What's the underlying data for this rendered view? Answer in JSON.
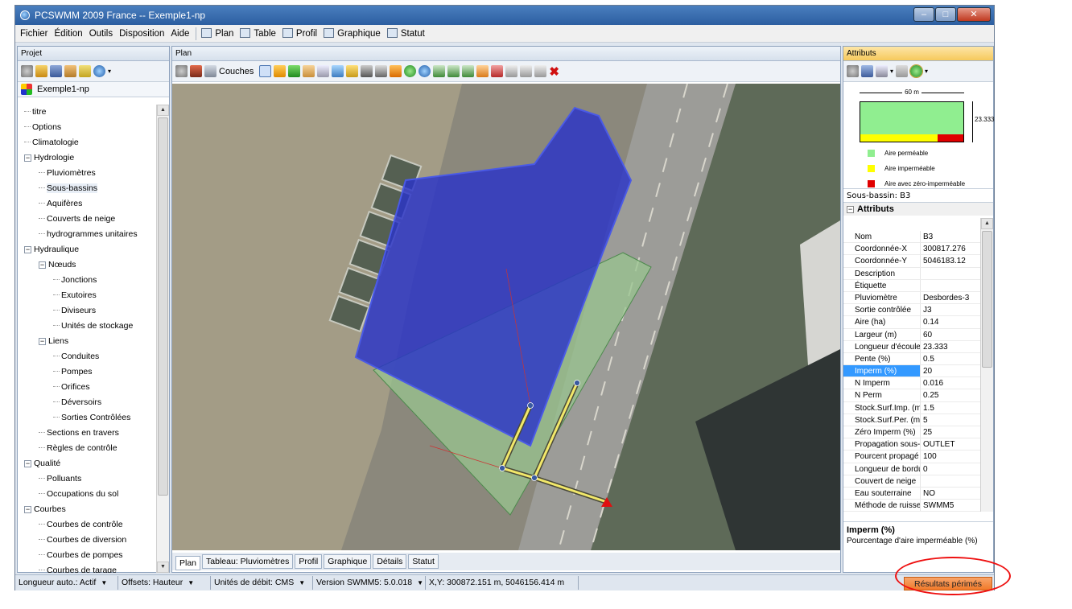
{
  "window": {
    "title": "PCSWMM 2009 France -- Exemple1-np",
    "controls": [
      "–",
      "□",
      "✕"
    ]
  },
  "menu": {
    "items": [
      "Fichier",
      "Édition",
      "Outils",
      "Disposition",
      "Aide"
    ],
    "view_items": [
      "Plan",
      "Table",
      "Profil",
      "Graphique",
      "Statut"
    ]
  },
  "project": {
    "header": "Projet",
    "root": "Exemple1-np",
    "tree": [
      {
        "label": "titre",
        "level": 0
      },
      {
        "label": "Options",
        "level": 0
      },
      {
        "label": "Climatologie",
        "level": 0
      },
      {
        "label": "Hydrologie",
        "level": 0,
        "expander": "−"
      },
      {
        "label": "Pluviomètres",
        "level": 1
      },
      {
        "label": "Sous-bassins",
        "level": 1
      },
      {
        "label": "Aquifères",
        "level": 1
      },
      {
        "label": "Couverts de neige",
        "level": 1
      },
      {
        "label": "hydrogrammes unitaires",
        "level": 1
      },
      {
        "label": "Hydraulique",
        "level": 0,
        "expander": "−"
      },
      {
        "label": "Nœuds",
        "level": 1,
        "expander": "−"
      },
      {
        "label": "Jonctions",
        "level": 2
      },
      {
        "label": "Exutoires",
        "level": 2
      },
      {
        "label": "Diviseurs",
        "level": 2
      },
      {
        "label": "Unités de stockage",
        "level": 2
      },
      {
        "label": "Liens",
        "level": 1,
        "expander": "−"
      },
      {
        "label": "Conduites",
        "level": 2
      },
      {
        "label": "Pompes",
        "level": 2
      },
      {
        "label": "Orifices",
        "level": 2
      },
      {
        "label": "Déversoirs",
        "level": 2
      },
      {
        "label": "Sorties Contrôlées",
        "level": 2
      },
      {
        "label": "Sections en travers",
        "level": 1
      },
      {
        "label": "Règles de contrôle",
        "level": 1
      },
      {
        "label": "Qualité",
        "level": 0,
        "expander": "−"
      },
      {
        "label": "Polluants",
        "level": 1
      },
      {
        "label": "Occupations du sol",
        "level": 1
      },
      {
        "label": "Courbes",
        "level": 0,
        "expander": "−"
      },
      {
        "label": "Courbes de contrôle",
        "level": 1
      },
      {
        "label": "Courbes de diversion",
        "level": 1
      },
      {
        "label": "Courbes de pompes",
        "level": 1
      },
      {
        "label": "Courbes de tarage",
        "level": 1
      }
    ]
  },
  "plan": {
    "header": "Plan",
    "layers_label": "Couches",
    "tabs": [
      "Plan",
      "Tableau: Pluviomètres",
      "Profil",
      "Graphique",
      "Détails",
      "Statut"
    ]
  },
  "attributes": {
    "header": "Attributs",
    "width_label": "60 m",
    "length_label": "23.333",
    "legend": [
      {
        "label": "Aire perméable",
        "color": "#90ee90"
      },
      {
        "label": "Aire imperméable",
        "color": "#ffff00"
      },
      {
        "label": "Aire avec zéro-imperméable",
        "color": "#e00000"
      }
    ],
    "subtitle": "Sous-bassin:  B3",
    "section": "Attributs",
    "rows": [
      {
        "k": "Nom",
        "v": "B3"
      },
      {
        "k": "Coordonnée-X",
        "v": "300817.276"
      },
      {
        "k": "Coordonnée-Y",
        "v": "5046183.12"
      },
      {
        "k": "Description",
        "v": ""
      },
      {
        "k": "Étiquette",
        "v": ""
      },
      {
        "k": "Pluviomètre",
        "v": "Desbordes-3"
      },
      {
        "k": "Sortie contrôlée",
        "v": "J3"
      },
      {
        "k": "Aire (ha)",
        "v": "0.14"
      },
      {
        "k": "Largeur (m)",
        "v": "60"
      },
      {
        "k": "Longueur d'écoulem",
        "v": "23.333"
      },
      {
        "k": "Pente (%)",
        "v": "0.5"
      },
      {
        "k": "Imperm (%)",
        "v": "20"
      },
      {
        "k": "N Imperm",
        "v": "0.016"
      },
      {
        "k": "N Perm",
        "v": "0.25"
      },
      {
        "k": "Stock.Surf.Imp. (mm",
        "v": "1.5"
      },
      {
        "k": "Stock.Surf.Per. (mm)",
        "v": "5"
      },
      {
        "k": "Zéro Imperm (%)",
        "v": "25"
      },
      {
        "k": "Propagation sous-pa",
        "v": "OUTLET"
      },
      {
        "k": "Pourcent propagé (%",
        "v": "100"
      },
      {
        "k": "Longueur de bordure",
        "v": "0"
      },
      {
        "k": "Couvert de neige",
        "v": ""
      },
      {
        "k": "Eau souterraine",
        "v": "NO"
      },
      {
        "k": "Méthode de ruisselle",
        "v": "SWMM5"
      }
    ],
    "selected_row": "Imperm (%)",
    "description_title": "Imperm (%)",
    "description_text": "Pourcentage d'aire imperméable (%)"
  },
  "status": {
    "length_auto": "Longueur auto.: Actif",
    "offsets": "Offsets: Hauteur",
    "flow_units": "Unités de débit: CMS",
    "version": "Version SWMM5: 5.0.018",
    "coords": "X,Y: 300872.151 m, 5046156.414 m",
    "stale_results": "Résultats périmés"
  },
  "colors": {
    "accent": "#f6c95c",
    "stale": "#f17a2a",
    "subcatchment": "#2a33c8",
    "conduit": "#f2e86a",
    "outlet": "#e01010"
  }
}
